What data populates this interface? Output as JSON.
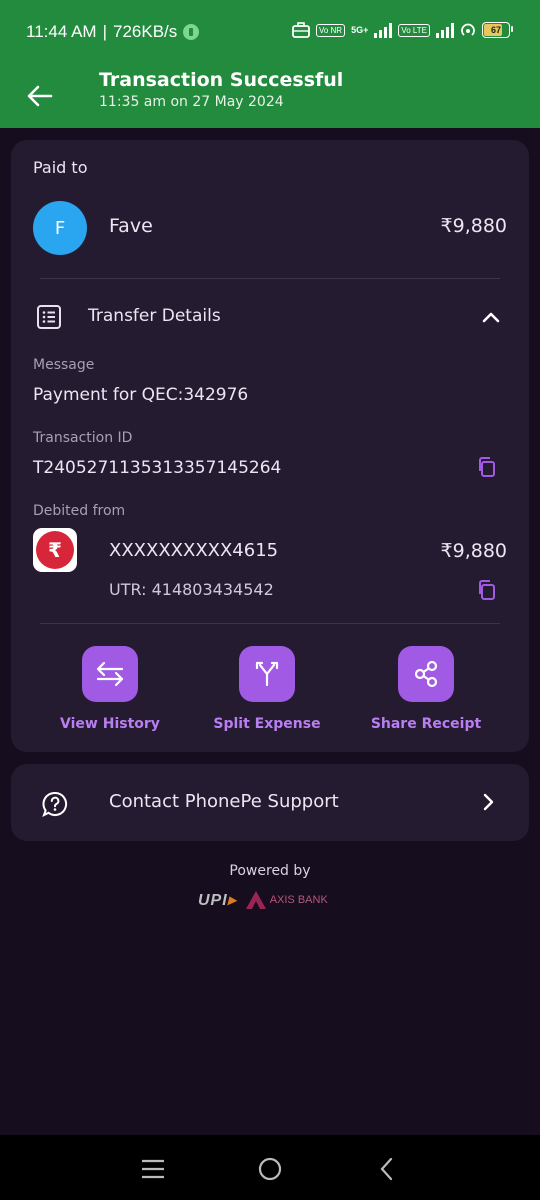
{
  "status_bar": {
    "time": "11:44 AM",
    "speed": "726KB/s",
    "net1_badge": "Vo NR",
    "net1_type": "5G+",
    "net2_badge": "Vo LTE",
    "battery": "67"
  },
  "header": {
    "title": "Transaction Successful",
    "subtitle": "11:35 am on 27 May 2024"
  },
  "paid_to": {
    "label": "Paid to",
    "avatar_initial": "F",
    "name": "Fave",
    "amount": "₹9,880"
  },
  "transfer": {
    "title": "Transfer Details",
    "message_label": "Message",
    "message_value": "Payment for QEC:342976",
    "txn_label": "Transaction ID",
    "txn_value": "T2405271135313357145264",
    "debited_label": "Debited from",
    "account": "XXXXXXXXXX4615",
    "debit_amount": "₹9,880",
    "utr": "UTR: 414803434542"
  },
  "actions": [
    {
      "label": "View History",
      "icon": "swap-arrows-icon"
    },
    {
      "label": "Split Expense",
      "icon": "split-icon"
    },
    {
      "label": "Share Receipt",
      "icon": "share-icon"
    }
  ],
  "support": {
    "label": "Contact PhonePe Support"
  },
  "footer": {
    "powered_by": "Powered by",
    "upi_text": "UPI",
    "bank": "AXIS BANK"
  },
  "colors": {
    "header_green": "#228b3e",
    "background": "#160d1f",
    "card": "#241b30",
    "accent_purple": "#a05ae3",
    "avatar_blue": "#2aa5ef"
  }
}
